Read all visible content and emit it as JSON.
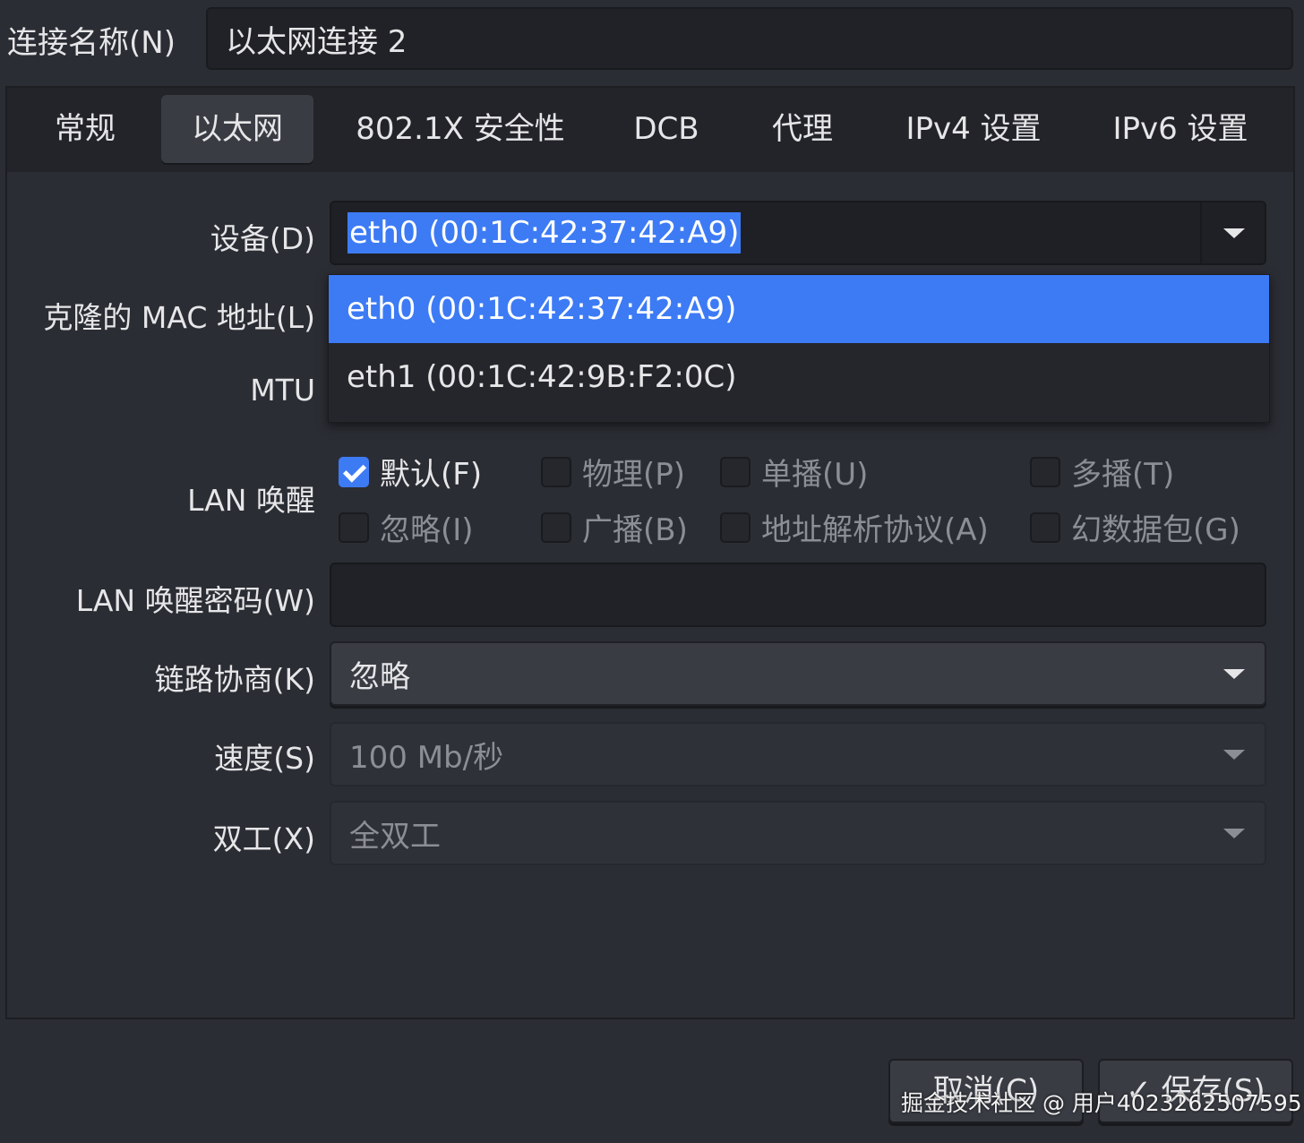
{
  "connection_name": {
    "label": "连接名称(N)",
    "value": "以太网连接 2"
  },
  "tabs": [
    {
      "label": "常规"
    },
    {
      "label": "以太网",
      "active": true
    },
    {
      "label": "802.1X 安全性"
    },
    {
      "label": "DCB"
    },
    {
      "label": "代理"
    },
    {
      "label": "IPv4 设置"
    },
    {
      "label": "IPv6 设置"
    }
  ],
  "ethernet": {
    "device_label": "设备(D)",
    "device_value": "eth0 (00:1C:42:37:42:A9)",
    "device_options": [
      "eth0 (00:1C:42:37:42:A9)",
      "eth1 (00:1C:42:9B:F2:0C)"
    ],
    "cloned_mac_label": "克隆的 MAC 地址(L)",
    "mtu_label": "MTU",
    "wol_label": "LAN 唤醒",
    "wol_options": [
      {
        "label": "默认(F)",
        "checked": true
      },
      {
        "label": "物理(P)",
        "checked": false
      },
      {
        "label": "单播(U)",
        "checked": false
      },
      {
        "label": "多播(T)",
        "checked": false
      },
      {
        "label": "忽略(I)",
        "checked": false
      },
      {
        "label": "广播(B)",
        "checked": false
      },
      {
        "label": "地址解析协议(A)",
        "checked": false
      },
      {
        "label": "幻数据包(G)",
        "checked": false
      }
    ],
    "wol_password_label": "LAN 唤醒密码(W)",
    "wol_password_value": "",
    "link_negotiation_label": "链路协商(K)",
    "link_negotiation_value": "忽略",
    "speed_label": "速度(S)",
    "speed_value": "100 Mb/秒",
    "duplex_label": "双工(X)",
    "duplex_value": "全双工"
  },
  "buttons": {
    "cancel": "取消(C)",
    "save": "✓ 保存(S)"
  },
  "watermark": "掘金技术社区 @ 用户4023262507595",
  "colors": {
    "accent": "#3d7bf5",
    "background": "#2b2d34"
  }
}
